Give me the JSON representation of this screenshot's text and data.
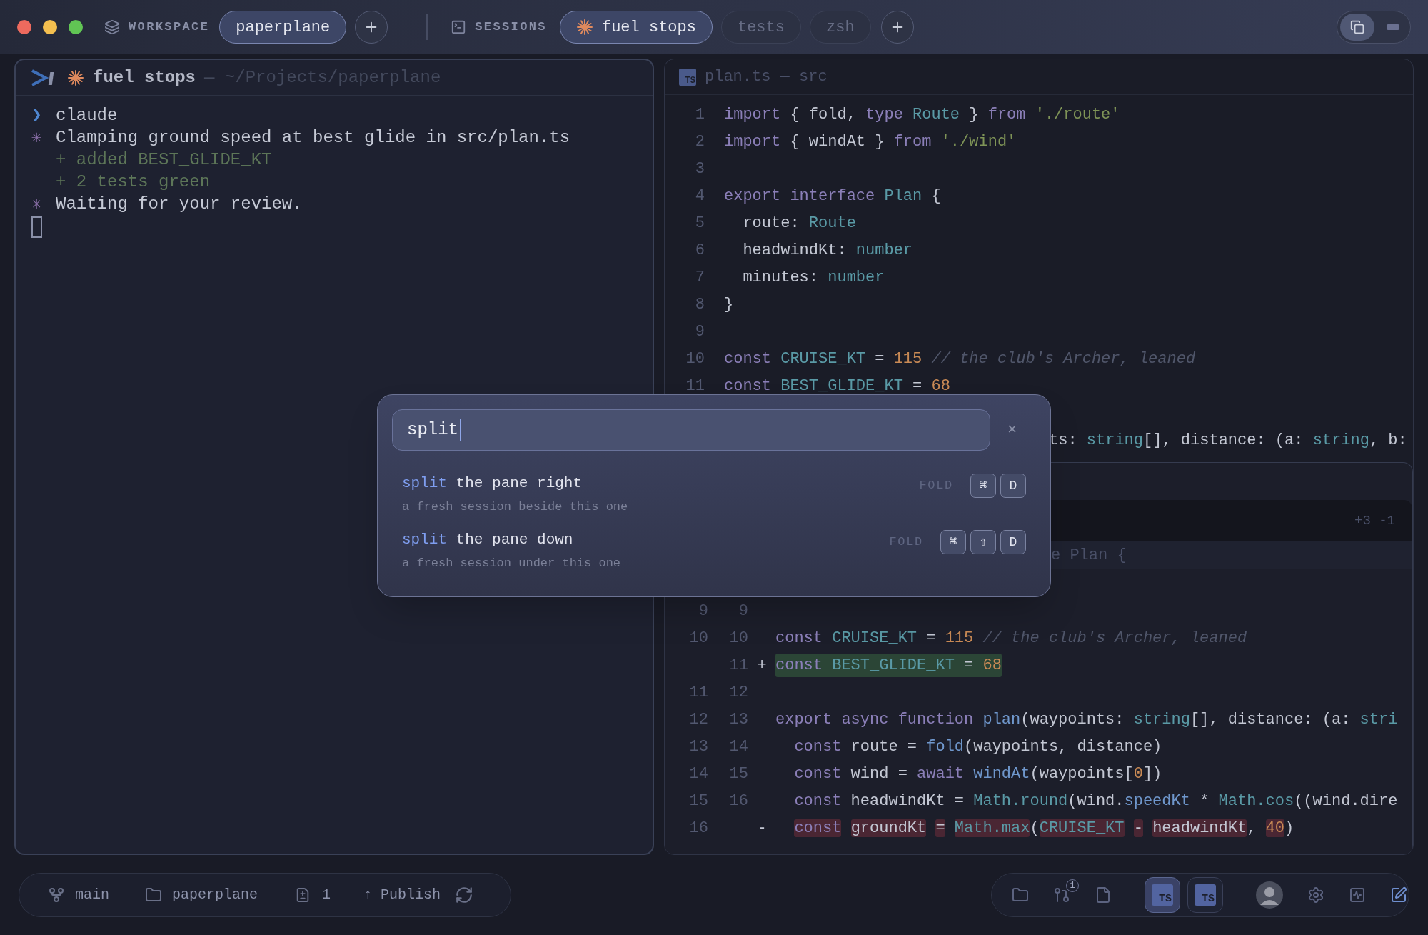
{
  "titlebar": {
    "workspace_label": "WORKSPACE",
    "workspaces": [
      {
        "label": "paperplane",
        "selected": true
      }
    ],
    "sessions_label": "SESSIONS",
    "sessions": [
      {
        "label": "fuel stops",
        "selected": true,
        "busy": true
      },
      {
        "label": "tests",
        "selected": false,
        "busy": false
      },
      {
        "label": "zsh",
        "selected": false,
        "busy": false
      }
    ]
  },
  "terminal": {
    "title": "fuel stops",
    "path": "— ~/Projects/paperplane",
    "lines": [
      {
        "kind": "prompt",
        "mark": "❯",
        "text": "claude"
      },
      {
        "kind": "status",
        "mark": "✳",
        "text": "Clamping ground speed at best glide in src/plan.ts"
      },
      {
        "kind": "added",
        "text": "+ added BEST_GLIDE_KT"
      },
      {
        "kind": "added",
        "text": "+ 2 tests green"
      },
      {
        "kind": "status",
        "mark": "✳",
        "text": "Waiting for your review."
      }
    ]
  },
  "editor": {
    "icon": "TS",
    "title": "plan.ts — src",
    "lines": [
      {
        "kind": "line",
        "number": "1",
        "tokens": [
          {
            "kind": "kw",
            "text": "import"
          },
          {
            "kind": "p",
            "text": " { fold, "
          },
          {
            "kind": "kw",
            "text": "type"
          },
          {
            "kind": "ty",
            "text": " Route"
          },
          {
            "kind": "p",
            "text": " } "
          },
          {
            "kind": "kw",
            "text": "from"
          },
          {
            "kind": "str",
            "text": " './route'"
          }
        ]
      },
      {
        "kind": "line",
        "number": "2",
        "tokens": [
          {
            "kind": "kw",
            "text": "import"
          },
          {
            "kind": "p",
            "text": " { windAt } "
          },
          {
            "kind": "kw",
            "text": "from"
          },
          {
            "kind": "str",
            "text": " './wind'"
          }
        ]
      },
      {
        "kind": "line",
        "number": "3"
      },
      {
        "kind": "line",
        "number": "4",
        "tokens": [
          {
            "kind": "kw",
            "text": "export interface"
          },
          {
            "kind": "ty",
            "text": " Plan"
          },
          {
            "kind": "p",
            "text": " {"
          }
        ]
      },
      {
        "kind": "line",
        "number": "5",
        "tokens": [
          {
            "kind": "p",
            "text": "  route: "
          },
          {
            "kind": "ty",
            "text": "Route"
          }
        ]
      },
      {
        "kind": "line",
        "number": "6",
        "tokens": [
          {
            "kind": "p",
            "text": "  headwindKt: "
          },
          {
            "kind": "ty",
            "text": "number"
          }
        ]
      },
      {
        "kind": "line",
        "number": "7",
        "tokens": [
          {
            "kind": "p",
            "text": "  minutes: "
          },
          {
            "kind": "ty",
            "text": "number"
          }
        ]
      },
      {
        "kind": "line",
        "number": "8",
        "tokens": [
          {
            "kind": "p",
            "text": "}"
          }
        ]
      },
      {
        "kind": "line",
        "number": "9"
      },
      {
        "kind": "line",
        "number": "10",
        "tokens": [
          {
            "kind": "kw",
            "text": "const"
          },
          {
            "kind": "ty",
            "text": " CRUISE_KT"
          },
          {
            "kind": "p",
            "text": " = "
          },
          {
            "kind": "num",
            "text": "115"
          },
          {
            "kind": "com",
            "text": " // the club's Archer, leaned"
          }
        ]
      },
      {
        "kind": "line",
        "number": "11",
        "tokens": [
          {
            "kind": "kw",
            "text": "const"
          },
          {
            "kind": "ty",
            "text": " BEST_GLIDE_KT"
          },
          {
            "kind": "p",
            "text": " = "
          },
          {
            "kind": "num",
            "text": "68"
          }
        ]
      },
      {
        "kind": "partial",
        "tokens": [
          {
            "kind": "p",
            "text": "ts: "
          },
          {
            "kind": "ty",
            "text": "string"
          },
          {
            "kind": "p",
            "text": "[], distance: (a: "
          },
          {
            "kind": "ty",
            "text": "string"
          },
          {
            "kind": "p",
            "text": ", b:"
          }
        ]
      }
    ]
  },
  "diff": {
    "stats": "+3 -1",
    "fold": "e Plan {",
    "lines": [
      {
        "old": "9",
        "new": "9",
        "kind": "context"
      },
      {
        "old": "10",
        "new": "10",
        "kind": "context",
        "tokens": [
          {
            "kind": "kw",
            "text": "const"
          },
          {
            "kind": "ty",
            "text": " CRUISE_KT"
          },
          {
            "kind": "p",
            "text": " = "
          },
          {
            "kind": "num",
            "text": "115"
          },
          {
            "kind": "com",
            "text": " // the club's Archer, leaned"
          }
        ]
      },
      {
        "new": "11",
        "kind": "added",
        "marker": "+",
        "tokens": [
          {
            "kind": "kw",
            "text": "const"
          },
          {
            "kind": "ty",
            "text": " BEST_GLIDE_KT"
          },
          {
            "kind": "p",
            "text": " = "
          },
          {
            "kind": "num",
            "text": "68"
          }
        ]
      },
      {
        "old": "11",
        "new": "12",
        "kind": "context"
      },
      {
        "old": "12",
        "new": "13",
        "kind": "context",
        "tokens": [
          {
            "kind": "kw",
            "text": "export async function"
          },
          {
            "kind": "fn",
            "text": " plan"
          },
          {
            "kind": "p",
            "text": "(waypoints: "
          },
          {
            "kind": "ty",
            "text": "string"
          },
          {
            "kind": "p",
            "text": "[], distance: (a: "
          },
          {
            "kind": "ty",
            "text": "stri"
          }
        ]
      },
      {
        "old": "13",
        "new": "14",
        "kind": "context",
        "tokens": [
          {
            "kind": "kw",
            "text": "  const"
          },
          {
            "kind": "p",
            "text": " route = "
          },
          {
            "kind": "fn",
            "text": "fold"
          },
          {
            "kind": "p",
            "text": "(waypoints, distance)"
          }
        ]
      },
      {
        "old": "14",
        "new": "15",
        "kind": "context",
        "tokens": [
          {
            "kind": "kw",
            "text": "  const"
          },
          {
            "kind": "p",
            "text": " wind = "
          },
          {
            "kind": "kw",
            "text": "await"
          },
          {
            "kind": "fn",
            "text": " windAt"
          },
          {
            "kind": "p",
            "text": "(waypoints["
          },
          {
            "kind": "num",
            "text": "0"
          },
          {
            "kind": "p",
            "text": "])"
          }
        ]
      },
      {
        "old": "15",
        "new": "16",
        "kind": "context",
        "tokens": [
          {
            "kind": "kw",
            "text": "  const"
          },
          {
            "kind": "p",
            "text": " headwindKt = "
          },
          {
            "kind": "ty",
            "text": "Math.round"
          },
          {
            "kind": "p",
            "text": "(wind."
          },
          {
            "kind": "fn",
            "text": "speedKt"
          },
          {
            "kind": "p",
            "text": " * "
          },
          {
            "kind": "ty",
            "text": "Math.cos"
          },
          {
            "kind": "p",
            "text": "((wind.dire"
          }
        ]
      },
      {
        "old": "16",
        "kind": "removed",
        "marker": "-",
        "tokens": [
          {
            "kind": "kw",
            "text": "  const",
            "highlighted": true
          },
          {
            "kind": "p",
            "text": " groundKt",
            "highlighted": true
          },
          {
            "kind": "p",
            "text": " =",
            "highlighted": true
          },
          {
            "kind": "ty",
            "text": " Math.max",
            "highlighted": true
          },
          {
            "kind": "p",
            "text": "(",
            "highlighted": false
          },
          {
            "kind": "ty",
            "text": "CRUISE_KT",
            "highlighted": true
          },
          {
            "kind": "p",
            "text": " -",
            "highlighted": true
          },
          {
            "kind": "p",
            "text": " headwindKt",
            "highlighted": true
          },
          {
            "kind": "p",
            "text": ", ",
            "highlighted": false
          },
          {
            "kind": "num",
            "text": "40",
            "highlighted": true
          },
          {
            "kind": "p",
            "text": ")",
            "highlighted": false
          }
        ]
      }
    ]
  },
  "palette": {
    "query": "split",
    "close": "×",
    "results": [
      {
        "match": "split",
        "title": " the pane right",
        "description": "a fresh session beside this one",
        "group": "FOLD",
        "keys": [
          "⌘",
          "D"
        ]
      },
      {
        "match": "split",
        "title": " the pane down",
        "description": "a fresh session under this one",
        "group": "FOLD",
        "keys": [
          "⌘",
          "⇧",
          "D"
        ]
      }
    ]
  },
  "statusbar": {
    "branch": "main",
    "project": "paperplane",
    "changes": "1",
    "publish": "↑ Publish",
    "tool_groups": [
      [
        {
          "kind": "folder"
        },
        {
          "kind": "pull",
          "badge": "1"
        },
        {
          "kind": "file"
        }
      ],
      [
        {
          "kind": "ts",
          "label": "TS",
          "selected": true
        },
        {
          "kind": "ts",
          "label": "TS",
          "selected": false
        }
      ],
      [
        {
          "kind": "avatar"
        },
        {
          "kind": "gear"
        },
        {
          "kind": "activity"
        },
        {
          "kind": "note"
        }
      ]
    ]
  }
}
